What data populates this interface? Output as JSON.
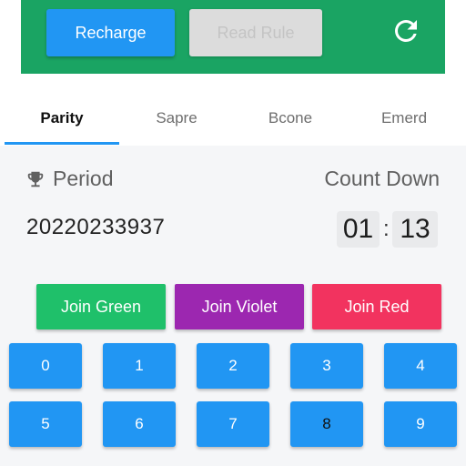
{
  "header": {
    "recharge_label": "Recharge",
    "read_rule_label": "Read Rule",
    "refresh_icon": "refresh-icon",
    "accent_color": "#1aa463"
  },
  "tabs": [
    "Parity",
    "Sapre",
    "Bcone",
    "Emerd"
  ],
  "active_tab": "Parity",
  "game": {
    "period_label": "Period",
    "countdown_label": "Count Down",
    "period_value": "20220233937",
    "countdown_minutes": "01",
    "countdown_colon": ":",
    "countdown_seconds": "13"
  },
  "join_buttons": [
    {
      "label": "Join Green",
      "color": "#1fc06a"
    },
    {
      "label": "Join Violet",
      "color": "#9c27b0"
    },
    {
      "label": "Join Red",
      "color": "#f2335f"
    }
  ],
  "numbers": [
    "0",
    "1",
    "2",
    "3",
    "4",
    "5",
    "6",
    "7",
    "8",
    "9"
  ]
}
